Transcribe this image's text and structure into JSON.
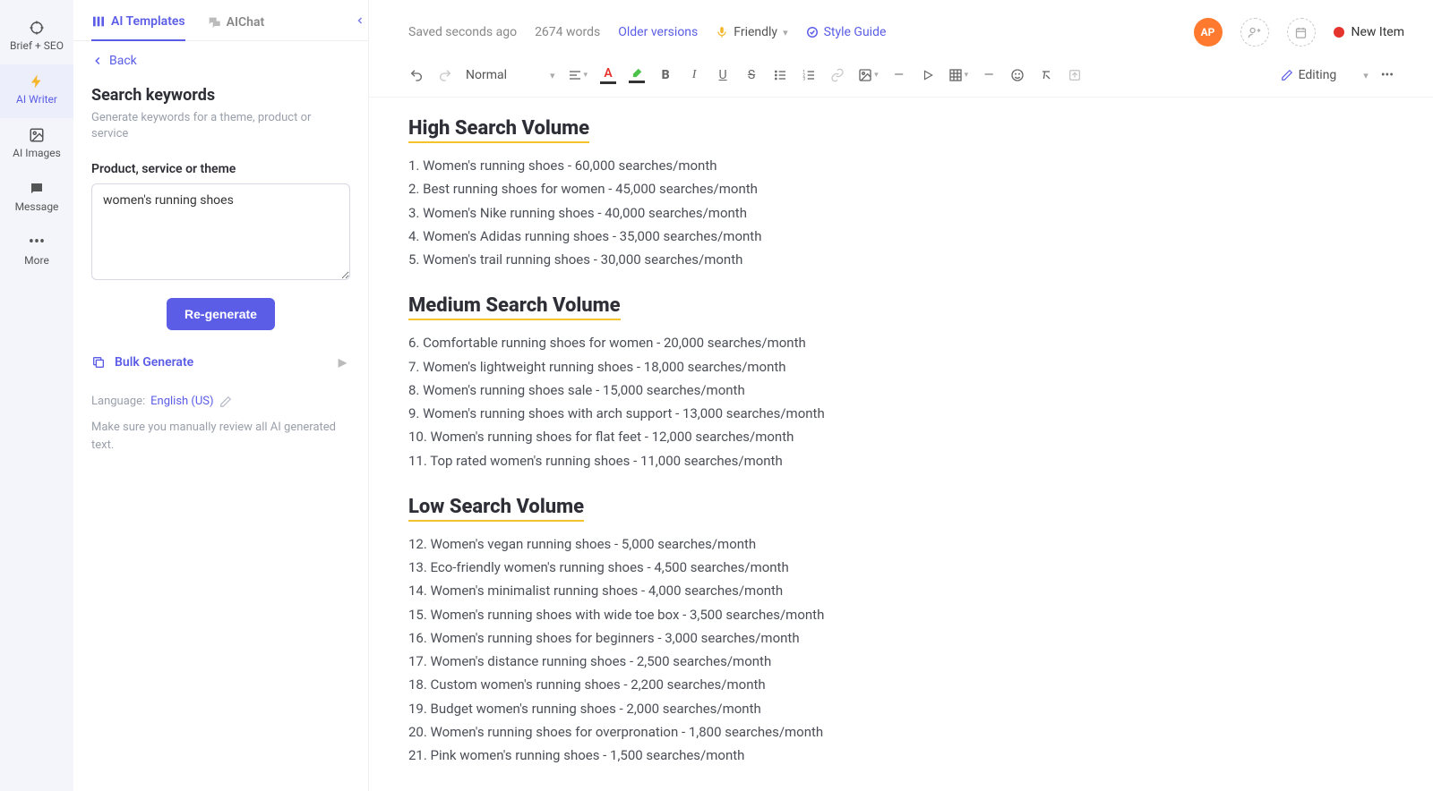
{
  "leftnav": {
    "items": [
      {
        "label": "Brief + SEO"
      },
      {
        "label": "AI Writer"
      },
      {
        "label": "AI Images"
      },
      {
        "label": "Message"
      },
      {
        "label": "More"
      }
    ]
  },
  "tabs": {
    "templates": "AI Templates",
    "chat": "AIChat"
  },
  "panel": {
    "back": "Back",
    "title": "Search keywords",
    "desc": "Generate keywords for a theme, product or service",
    "fieldlabel": "Product, service or theme",
    "input_value": "women's running shoes",
    "regen": "Re-generate",
    "bulk": "Bulk Generate",
    "lang_label": "Language:",
    "lang_value": "English (US)",
    "note": "Make sure you manually review all AI generated text."
  },
  "topbar": {
    "saved": "Saved seconds ago",
    "words": "2674 words",
    "older": "Older versions",
    "tone": "Friendly",
    "styleguide": "Style Guide",
    "ap": "AP",
    "newitem": "New Item"
  },
  "toolbar": {
    "styleselect": "Normal",
    "editing": "Editing"
  },
  "document": {
    "sections": [
      {
        "heading": "High Search Volume",
        "items": [
          "1. Women's running shoes - 60,000 searches/month",
          "2. Best running shoes for women - 45,000 searches/month",
          "3. Women's Nike running shoes - 40,000 searches/month",
          "4. Women's Adidas running shoes - 35,000 searches/month",
          "5. Women's trail running shoes - 30,000 searches/month"
        ]
      },
      {
        "heading": "Medium Search Volume",
        "items": [
          "6. Comfortable running shoes for women - 20,000 searches/month",
          "7. Women's lightweight running shoes - 18,000 searches/month",
          "8. Women's running shoes sale - 15,000 searches/month",
          "9. Women's running shoes with arch support - 13,000 searches/month",
          "10. Women's running shoes for flat feet - 12,000 searches/month",
          "11. Top rated women's running shoes - 11,000 searches/month"
        ]
      },
      {
        "heading": "Low Search Volume",
        "items": [
          "12. Women's vegan running shoes - 5,000 searches/month",
          "13. Eco-friendly women's running shoes - 4,500 searches/month",
          "14. Women's minimalist running shoes - 4,000 searches/month",
          "15. Women's running shoes with wide toe box - 3,500 searches/month",
          "16. Women's running shoes for beginners - 3,000 searches/month",
          "17. Women's distance running shoes - 2,500 searches/month",
          "18. Custom women's running shoes - 2,200 searches/month",
          "19. Budget women's running shoes - 2,000 searches/month",
          "20. Women's running shoes for overpronation - 1,800 searches/month",
          "21. Pink women's running shoes - 1,500 searches/month"
        ]
      }
    ]
  }
}
